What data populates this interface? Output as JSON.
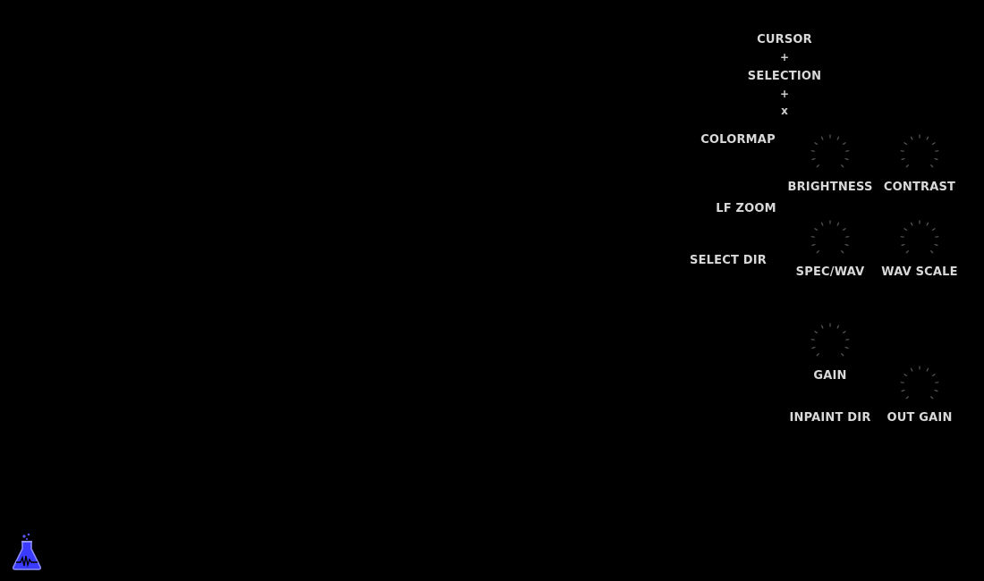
{
  "controls": {
    "cursor_label": "CURSOR",
    "cursor_plus": "+",
    "selection_label": "SELECTION",
    "selection_plus": "+",
    "close_x": "x",
    "colormap_label": "COLORMAP",
    "lf_zoom_label": "LF ZOOM",
    "select_dir_label": "SELECT DIR",
    "inpaint_dir_label": "INPAINT DIR"
  },
  "knobs": {
    "brightness": "BRIGHTNESS",
    "contrast": "CONTRAST",
    "spec_wav": "SPEC/WAV",
    "wav_scale": "WAV SCALE",
    "gain": "GAIN",
    "out_gain": "OUT GAIN"
  },
  "colors": {
    "background": "#000000",
    "label": "#d9d9d9",
    "knob_tick": "#5a5a5a",
    "logo_accent": "#3b3bff"
  },
  "icons": {
    "logo": "flask-waveform-icon"
  }
}
